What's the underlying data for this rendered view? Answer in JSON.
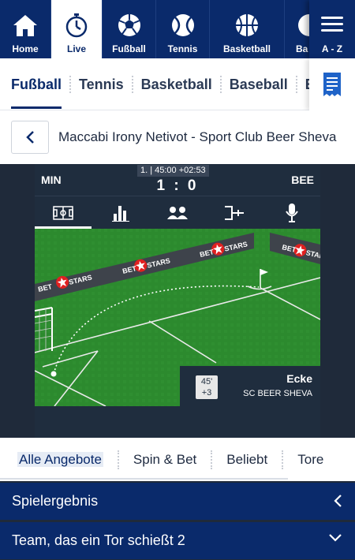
{
  "topnav": {
    "items": [
      {
        "label": "Home",
        "icon": "home-icon"
      },
      {
        "label": "Live",
        "icon": "stopwatch-icon",
        "active": true
      },
      {
        "label": "Fußball",
        "icon": "soccer-ball-icon"
      },
      {
        "label": "Tennis",
        "icon": "tennis-ball-icon"
      },
      {
        "label": "Basketball",
        "icon": "basketball-icon"
      },
      {
        "label": "Ba",
        "icon": "baseball-icon"
      }
    ],
    "az_label": "A - Z"
  },
  "sport_tabs": [
    "Fußball",
    "Tennis",
    "Basketball",
    "Baseball",
    "Ei"
  ],
  "match": {
    "title": "Maccabi Irony Netivot - Sport Club Beer Sheva"
  },
  "tracker": {
    "home_short": "MIN",
    "away_short": "BEE",
    "clock": "1. | 45:00 +02:53",
    "score": "1 : 0",
    "tabs": [
      "pitch-icon",
      "stats-icon",
      "lineups-icon",
      "bracket-icon",
      "microphone-icon"
    ],
    "ad_text": "BETSTARS",
    "event": {
      "minute": "45'",
      "added": "+3",
      "name": "Ecke",
      "team": "SC BEER SHEVA"
    }
  },
  "offer_tabs": [
    "Alle Angebote",
    "Spin & Bet",
    "Beliebt",
    "Tore"
  ],
  "markets": {
    "first": "Spielergebnis",
    "second": "Team, das ein Tor schießt 2"
  },
  "colors": {
    "brand_navy": "#0a2a6b",
    "pitch_green": "#2c8a2e",
    "tracker_bg": "#1f2d3e"
  }
}
